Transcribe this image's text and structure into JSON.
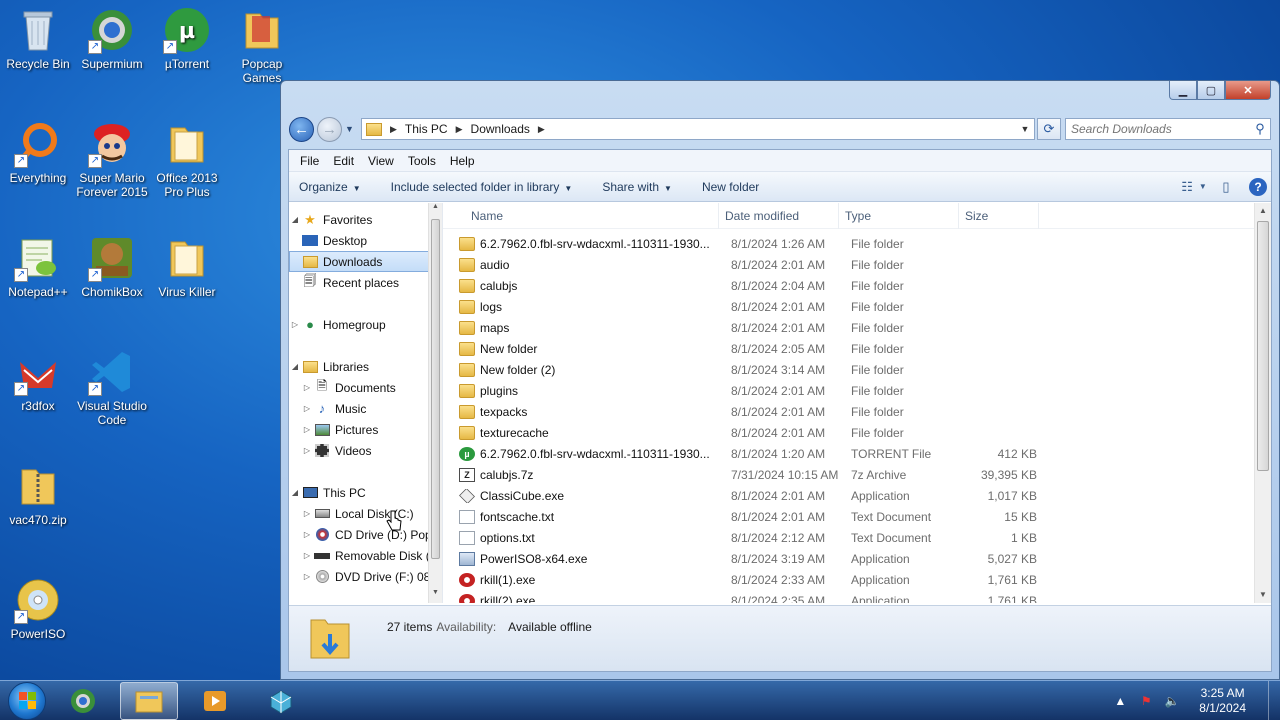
{
  "desktop_icons": [
    {
      "label": "Recycle Bin",
      "icon": "recycle-bin-icon"
    },
    {
      "label": "Supermium",
      "icon": "supermium-icon"
    },
    {
      "label": "µTorrent",
      "icon": "utorrent-icon"
    },
    {
      "label": "Popcap Games",
      "icon": "folder-icon"
    },
    {
      "label": "Everything",
      "icon": "everything-icon"
    },
    {
      "label": "Super Mario Forever 2015",
      "icon": "mario-icon"
    },
    {
      "label": "Office 2013 Pro Plus",
      "icon": "folder-icon"
    },
    {
      "label": "Notepad++",
      "icon": "notepadpp-icon"
    },
    {
      "label": "ChomikBox",
      "icon": "chomikbox-icon"
    },
    {
      "label": "Virus Killer",
      "icon": "folder-icon"
    },
    {
      "label": "r3dfox",
      "icon": "r3dfox-icon"
    },
    {
      "label": "Visual Studio Code",
      "icon": "vscode-icon"
    },
    {
      "label": "vac470.zip",
      "icon": "zip-folder-icon"
    },
    {
      "label": "PowerISO",
      "icon": "poweriso-icon"
    }
  ],
  "window": {
    "breadcrumb": [
      "This PC",
      "Downloads"
    ],
    "search_placeholder": "Search Downloads",
    "menu": [
      "File",
      "Edit",
      "View",
      "Tools",
      "Help"
    ],
    "toolbar": {
      "organize": "Organize",
      "include": "Include selected folder in library",
      "share": "Share with",
      "new_folder": "New folder"
    },
    "nav": {
      "favorites": "Favorites",
      "desktop": "Desktop",
      "downloads": "Downloads",
      "recent": "Recent places",
      "homegroup": "Homegroup",
      "libraries": "Libraries",
      "documents": "Documents",
      "music": "Music",
      "pictures": "Pictures",
      "videos": "Videos",
      "thispc": "This PC",
      "localdisk": "Local Disk (C:)",
      "cddrive": "CD Drive (D:) Pop",
      "removable": "Removable Disk (",
      "dvddrive": "DVD Drive (F:) 08_"
    },
    "columns": {
      "name": "Name",
      "date": "Date modified",
      "type": "Type",
      "size": "Size"
    },
    "files": [
      {
        "name": "6.2.7962.0.fbl-srv-wdacxml.-110311-1930...",
        "date": "8/1/2024 1:26 AM",
        "type": "File folder",
        "size": "",
        "icon": "folder"
      },
      {
        "name": "audio",
        "date": "8/1/2024 2:01 AM",
        "type": "File folder",
        "size": "",
        "icon": "folder"
      },
      {
        "name": "calubjs",
        "date": "8/1/2024 2:04 AM",
        "type": "File folder",
        "size": "",
        "icon": "folder"
      },
      {
        "name": "logs",
        "date": "8/1/2024 2:01 AM",
        "type": "File folder",
        "size": "",
        "icon": "folder"
      },
      {
        "name": "maps",
        "date": "8/1/2024 2:01 AM",
        "type": "File folder",
        "size": "",
        "icon": "folder"
      },
      {
        "name": "New folder",
        "date": "8/1/2024 2:05 AM",
        "type": "File folder",
        "size": "",
        "icon": "folder"
      },
      {
        "name": "New folder (2)",
        "date": "8/1/2024 3:14 AM",
        "type": "File folder",
        "size": "",
        "icon": "folder"
      },
      {
        "name": "plugins",
        "date": "8/1/2024 2:01 AM",
        "type": "File folder",
        "size": "",
        "icon": "folder"
      },
      {
        "name": "texpacks",
        "date": "8/1/2024 2:01 AM",
        "type": "File folder",
        "size": "",
        "icon": "folder"
      },
      {
        "name": "texturecache",
        "date": "8/1/2024 2:01 AM",
        "type": "File folder",
        "size": "",
        "icon": "folder"
      },
      {
        "name": "6.2.7962.0.fbl-srv-wdacxml.-110311-1930...",
        "date": "8/1/2024 1:20 AM",
        "type": "TORRENT File",
        "size": "412 KB",
        "icon": "torrent"
      },
      {
        "name": "calubjs.7z",
        "date": "7/31/2024 10:15 AM",
        "type": "7z Archive",
        "size": "39,395 KB",
        "icon": "z7"
      },
      {
        "name": "ClassiCube.exe",
        "date": "8/1/2024 2:01 AM",
        "type": "Application",
        "size": "1,017 KB",
        "icon": "cube"
      },
      {
        "name": "fontscache.txt",
        "date": "8/1/2024 2:01 AM",
        "type": "Text Document",
        "size": "15 KB",
        "icon": "doc"
      },
      {
        "name": "options.txt",
        "date": "8/1/2024 2:12 AM",
        "type": "Text Document",
        "size": "1 KB",
        "icon": "doc"
      },
      {
        "name": "PowerISO8-x64.exe",
        "date": "8/1/2024 3:19 AM",
        "type": "Application",
        "size": "5,027 KB",
        "icon": "iso"
      },
      {
        "name": "rkill(1).exe",
        "date": "8/1/2024 2:33 AM",
        "type": "Application",
        "size": "1,761 KB",
        "icon": "rkill"
      },
      {
        "name": "rkill(2).exe",
        "date": "8/1/2024 2:35 AM",
        "type": "Application",
        "size": "1,761 KB",
        "icon": "rkill"
      }
    ],
    "status": {
      "count": "27 items",
      "avail_label": "Availability:",
      "avail": "Available offline"
    }
  },
  "taskbar": {
    "time": "3:25 AM",
    "date": "8/1/2024"
  }
}
